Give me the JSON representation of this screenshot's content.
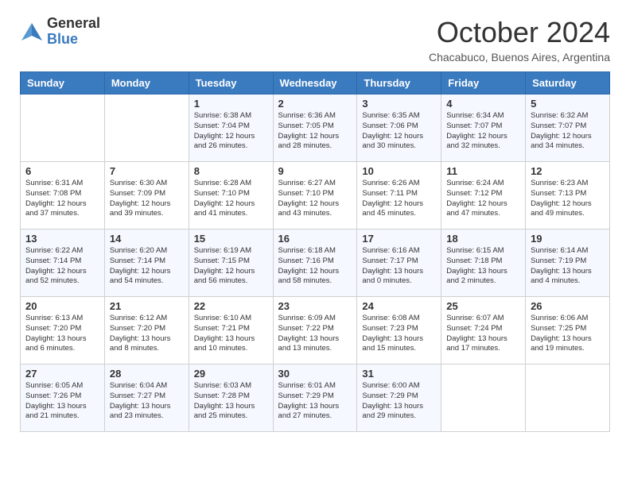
{
  "logo": {
    "general": "General",
    "blue": "Blue"
  },
  "title": "October 2024",
  "subtitle": "Chacabuco, Buenos Aires, Argentina",
  "weekdays": [
    "Sunday",
    "Monday",
    "Tuesday",
    "Wednesday",
    "Thursday",
    "Friday",
    "Saturday"
  ],
  "weeks": [
    [
      {
        "day": "",
        "info": ""
      },
      {
        "day": "",
        "info": ""
      },
      {
        "day": "1",
        "info": "Sunrise: 6:38 AM\nSunset: 7:04 PM\nDaylight: 12 hours and 26 minutes."
      },
      {
        "day": "2",
        "info": "Sunrise: 6:36 AM\nSunset: 7:05 PM\nDaylight: 12 hours and 28 minutes."
      },
      {
        "day": "3",
        "info": "Sunrise: 6:35 AM\nSunset: 7:06 PM\nDaylight: 12 hours and 30 minutes."
      },
      {
        "day": "4",
        "info": "Sunrise: 6:34 AM\nSunset: 7:07 PM\nDaylight: 12 hours and 32 minutes."
      },
      {
        "day": "5",
        "info": "Sunrise: 6:32 AM\nSunset: 7:07 PM\nDaylight: 12 hours and 34 minutes."
      }
    ],
    [
      {
        "day": "6",
        "info": "Sunrise: 6:31 AM\nSunset: 7:08 PM\nDaylight: 12 hours and 37 minutes."
      },
      {
        "day": "7",
        "info": "Sunrise: 6:30 AM\nSunset: 7:09 PM\nDaylight: 12 hours and 39 minutes."
      },
      {
        "day": "8",
        "info": "Sunrise: 6:28 AM\nSunset: 7:10 PM\nDaylight: 12 hours and 41 minutes."
      },
      {
        "day": "9",
        "info": "Sunrise: 6:27 AM\nSunset: 7:10 PM\nDaylight: 12 hours and 43 minutes."
      },
      {
        "day": "10",
        "info": "Sunrise: 6:26 AM\nSunset: 7:11 PM\nDaylight: 12 hours and 45 minutes."
      },
      {
        "day": "11",
        "info": "Sunrise: 6:24 AM\nSunset: 7:12 PM\nDaylight: 12 hours and 47 minutes."
      },
      {
        "day": "12",
        "info": "Sunrise: 6:23 AM\nSunset: 7:13 PM\nDaylight: 12 hours and 49 minutes."
      }
    ],
    [
      {
        "day": "13",
        "info": "Sunrise: 6:22 AM\nSunset: 7:14 PM\nDaylight: 12 hours and 52 minutes."
      },
      {
        "day": "14",
        "info": "Sunrise: 6:20 AM\nSunset: 7:14 PM\nDaylight: 12 hours and 54 minutes."
      },
      {
        "day": "15",
        "info": "Sunrise: 6:19 AM\nSunset: 7:15 PM\nDaylight: 12 hours and 56 minutes."
      },
      {
        "day": "16",
        "info": "Sunrise: 6:18 AM\nSunset: 7:16 PM\nDaylight: 12 hours and 58 minutes."
      },
      {
        "day": "17",
        "info": "Sunrise: 6:16 AM\nSunset: 7:17 PM\nDaylight: 13 hours and 0 minutes."
      },
      {
        "day": "18",
        "info": "Sunrise: 6:15 AM\nSunset: 7:18 PM\nDaylight: 13 hours and 2 minutes."
      },
      {
        "day": "19",
        "info": "Sunrise: 6:14 AM\nSunset: 7:19 PM\nDaylight: 13 hours and 4 minutes."
      }
    ],
    [
      {
        "day": "20",
        "info": "Sunrise: 6:13 AM\nSunset: 7:20 PM\nDaylight: 13 hours and 6 minutes."
      },
      {
        "day": "21",
        "info": "Sunrise: 6:12 AM\nSunset: 7:20 PM\nDaylight: 13 hours and 8 minutes."
      },
      {
        "day": "22",
        "info": "Sunrise: 6:10 AM\nSunset: 7:21 PM\nDaylight: 13 hours and 10 minutes."
      },
      {
        "day": "23",
        "info": "Sunrise: 6:09 AM\nSunset: 7:22 PM\nDaylight: 13 hours and 13 minutes."
      },
      {
        "day": "24",
        "info": "Sunrise: 6:08 AM\nSunset: 7:23 PM\nDaylight: 13 hours and 15 minutes."
      },
      {
        "day": "25",
        "info": "Sunrise: 6:07 AM\nSunset: 7:24 PM\nDaylight: 13 hours and 17 minutes."
      },
      {
        "day": "26",
        "info": "Sunrise: 6:06 AM\nSunset: 7:25 PM\nDaylight: 13 hours and 19 minutes."
      }
    ],
    [
      {
        "day": "27",
        "info": "Sunrise: 6:05 AM\nSunset: 7:26 PM\nDaylight: 13 hours and 21 minutes."
      },
      {
        "day": "28",
        "info": "Sunrise: 6:04 AM\nSunset: 7:27 PM\nDaylight: 13 hours and 23 minutes."
      },
      {
        "day": "29",
        "info": "Sunrise: 6:03 AM\nSunset: 7:28 PM\nDaylight: 13 hours and 25 minutes."
      },
      {
        "day": "30",
        "info": "Sunrise: 6:01 AM\nSunset: 7:29 PM\nDaylight: 13 hours and 27 minutes."
      },
      {
        "day": "31",
        "info": "Sunrise: 6:00 AM\nSunset: 7:29 PM\nDaylight: 13 hours and 29 minutes."
      },
      {
        "day": "",
        "info": ""
      },
      {
        "day": "",
        "info": ""
      }
    ]
  ]
}
